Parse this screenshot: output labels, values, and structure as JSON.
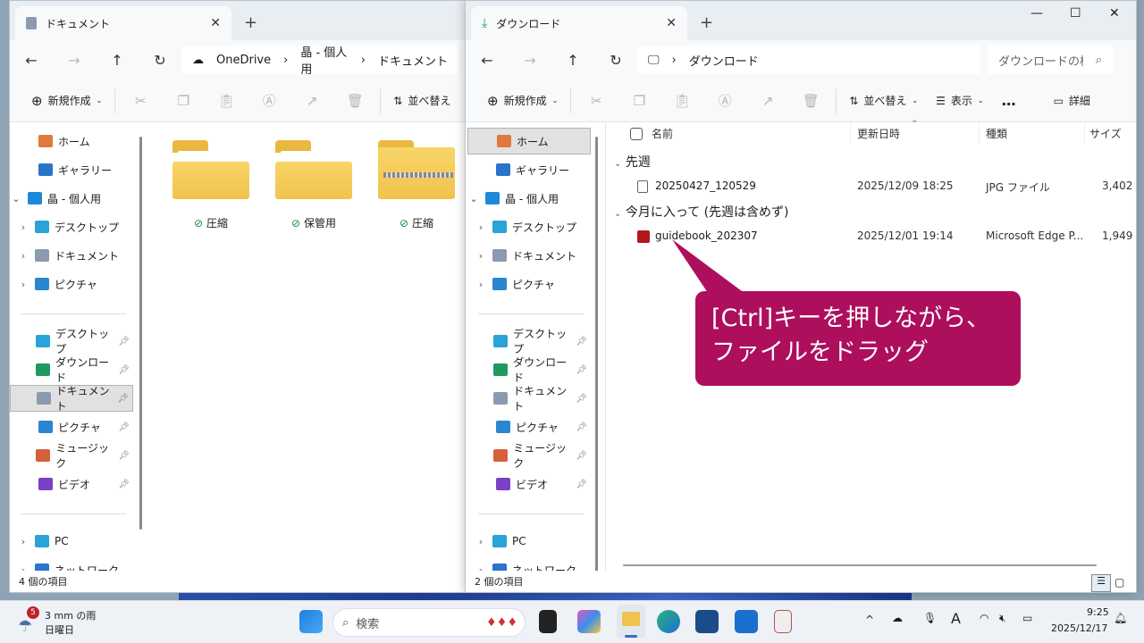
{
  "left_window": {
    "tab_title": "ドキュメント",
    "breadcrumb": [
      "OneDrive",
      "晶 - 個人用",
      "ドキュメント"
    ],
    "toolbar": {
      "new": "新規作成",
      "sort": "並べ替え"
    },
    "nav": [
      {
        "label": "ホーム",
        "icon": "home-icon",
        "color": "#e07a3c",
        "chev": ""
      },
      {
        "label": "ギャラリー",
        "icon": "gallery-icon",
        "color": "#2a74c9",
        "chev": ""
      },
      {
        "label": "晶 - 個人用",
        "icon": "onedrive-icon",
        "color": "#1e88d8",
        "chev": "v"
      },
      {
        "label": "デスクトップ",
        "icon": "desktop-icon",
        "color": "#2aa3d8",
        "chev": ">"
      },
      {
        "label": "ドキュメント",
        "icon": "document-icon",
        "color": "#8a9bb0",
        "chev": ">"
      },
      {
        "label": "ピクチャ",
        "icon": "pictures-icon",
        "color": "#2a86d0",
        "chev": ">"
      }
    ],
    "quick": [
      {
        "label": "デスクトップ",
        "icon": "desktop-icon",
        "color": "#2aa3d8"
      },
      {
        "label": "ダウンロード",
        "icon": "download-icon",
        "color": "#1f9a5f"
      },
      {
        "label": "ドキュメント",
        "icon": "document-icon",
        "color": "#8a9bb0"
      },
      {
        "label": "ピクチャ",
        "icon": "pictures-icon",
        "color": "#2a86d0"
      },
      {
        "label": "ミュージック",
        "icon": "music-icon",
        "color": "#d5603c"
      },
      {
        "label": "ビデオ",
        "icon": "video-icon",
        "color": "#7b3fc8"
      }
    ],
    "bottom": [
      {
        "label": "PC",
        "icon": "pc-icon",
        "color": "#2aa3d8"
      },
      {
        "label": "ネットワーク",
        "icon": "network-icon",
        "color": "#2a74c9"
      }
    ],
    "folders": [
      {
        "label": "圧縮",
        "type": "docs"
      },
      {
        "label": "保管用",
        "type": "plain"
      },
      {
        "label": "圧縮",
        "type": "zip"
      }
    ],
    "status": "4 個の項目",
    "selected_quick": "ドキュメント"
  },
  "right_window": {
    "tab_title": "ダウンロード",
    "breadcrumb": [
      "ダウンロード"
    ],
    "search_placeholder": "ダウンロードの検索",
    "toolbar": {
      "new": "新規作成",
      "sort": "並べ替え",
      "view": "表示",
      "more": "…",
      "details": "詳細"
    },
    "columns": [
      "名前",
      "更新日時",
      "種類",
      "サイズ"
    ],
    "groups": [
      {
        "label": "先週",
        "files": [
          {
            "name": "20250427_120529",
            "date": "2025/12/09 18:25",
            "type": "JPG ファイル",
            "size": "3,402",
            "icon": "jpg-file-icon"
          }
        ]
      },
      {
        "label": "今月に入って (先週は含めず)",
        "files": [
          {
            "name": "guidebook_202307",
            "date": "2025/12/01 19:14",
            "type": "Microsoft Edge P...",
            "size": "1,949",
            "icon": "pdf-file-icon"
          }
        ]
      }
    ],
    "status": "2 個の項目"
  },
  "callout": {
    "line1": "[Ctrl]キーを押しながら、",
    "line2": "ファイルをドラッグ",
    "color": "#ad0f5d"
  },
  "taskbar": {
    "weather_badge": "5",
    "weather": "3 mm の雨",
    "day": "日曜日",
    "search": "検索",
    "time": "9:25",
    "date": "2025/12/17"
  }
}
